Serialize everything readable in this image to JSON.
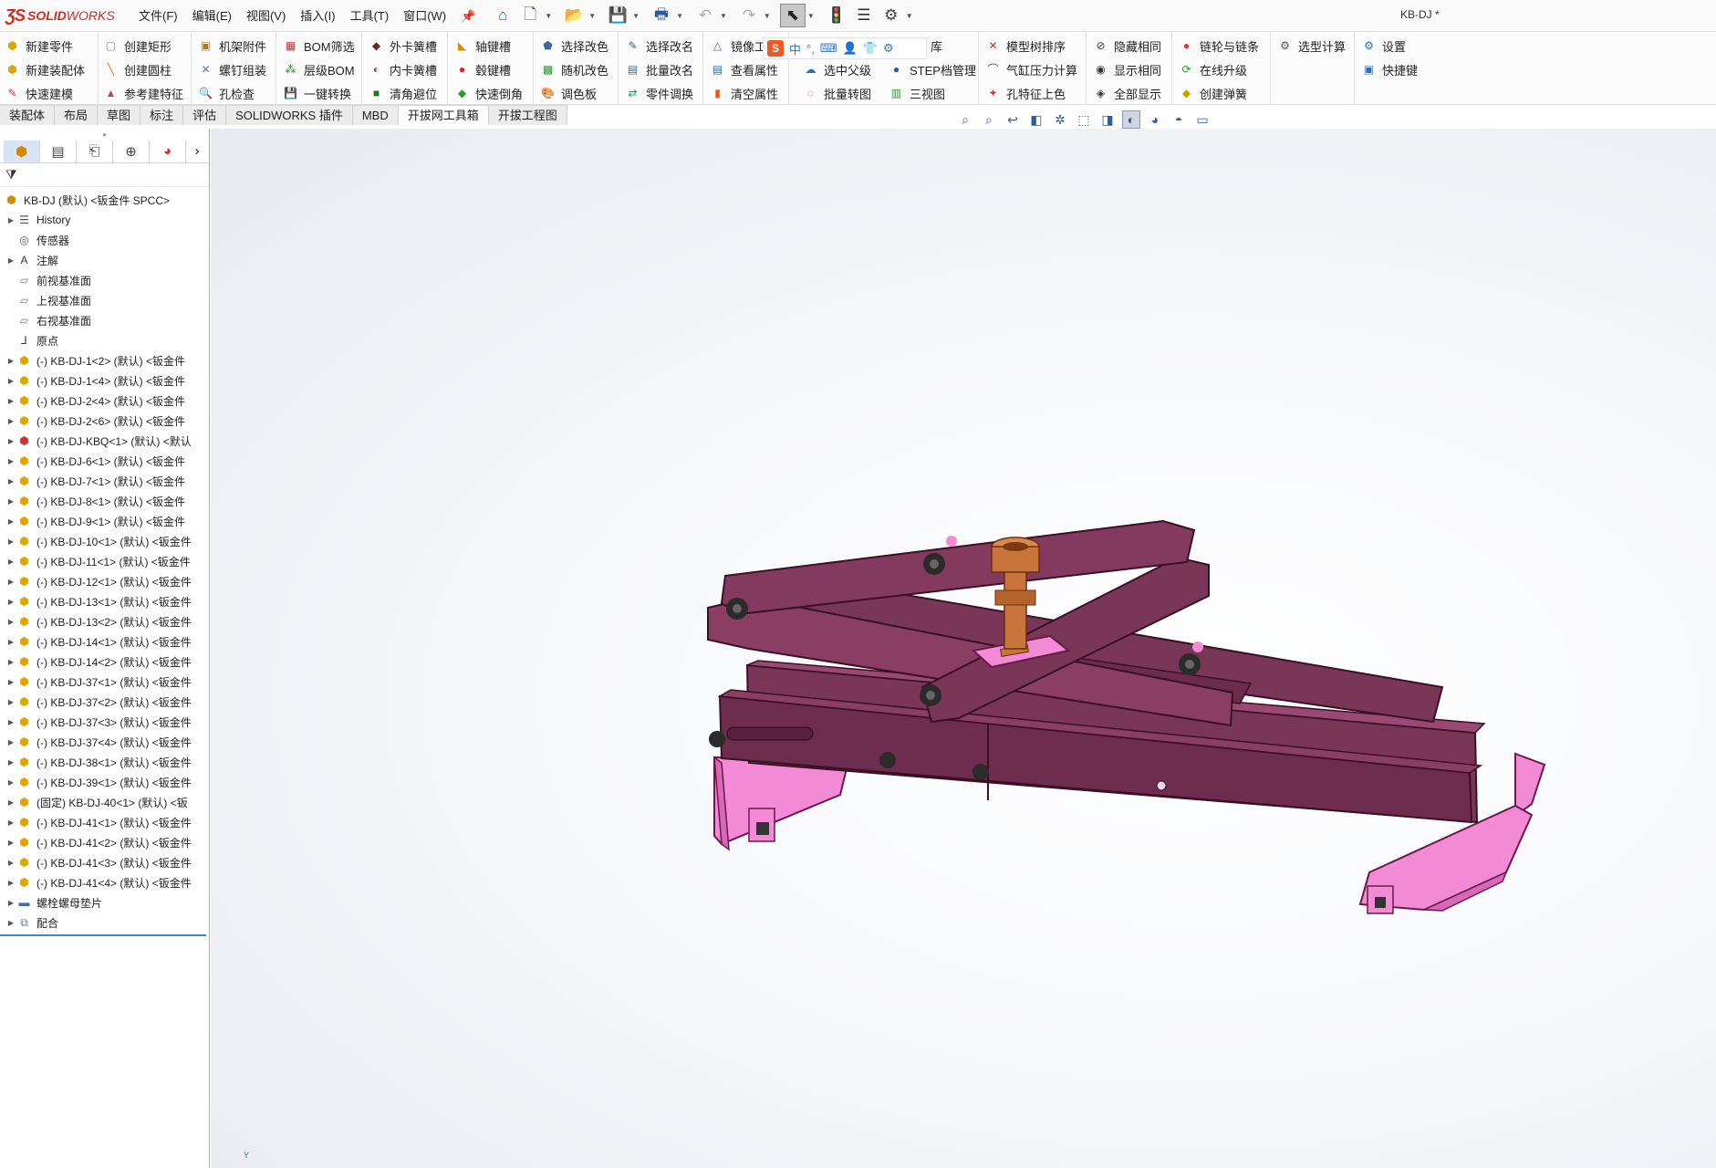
{
  "app": {
    "logo_mark": "ƷS",
    "logo_solid": "SOLID",
    "logo_works": "WORKS",
    "document_title": "KB-DJ *"
  },
  "menu": [
    "文件(F)",
    "编辑(E)",
    "视图(V)",
    "插入(I)",
    "工具(T)",
    "窗口(W)"
  ],
  "quick_access_icons": [
    "home-icon",
    "new-document-icon",
    "open-icon",
    "save-icon",
    "print-icon",
    "undo-icon",
    "redo-icon",
    "select-icon",
    "traffic-light-icon",
    "options-list-icon",
    "settings-gear-icon"
  ],
  "command_manager": {
    "col1": [
      "新建零件",
      "新建装配体",
      "快速建模"
    ],
    "col2": [
      "创建矩形",
      "创建圆柱",
      "参考建特征"
    ],
    "col3": [
      "机架附件",
      "螺钉组装",
      "孔检查"
    ],
    "col4": [
      "BOM筛选",
      "层级BOM",
      "一键转换"
    ],
    "col5": [
      "外卡簧槽",
      "内卡簧槽",
      "清角避位"
    ],
    "col6": [
      "轴键槽",
      "毂键槽",
      "快速倒角"
    ],
    "col7": [
      "选择改色",
      "随机改色",
      "调色板"
    ],
    "col8": [
      "选择改名",
      "批量改名",
      "零件调换"
    ],
    "col9": [
      "镜像工",
      "查看属性",
      "清空属性"
    ],
    "col10": [
      "库",
      "选中父级",
      "批量转图"
    ],
    "col10b": [
      "STEP档管理",
      "三视图"
    ],
    "col11": [
      "模型树排序",
      "气缸压力计算",
      "孔特征上色"
    ],
    "col12": [
      "隐藏相同",
      "显示相同",
      "全部显示"
    ],
    "col13": [
      "链轮与链条",
      "在线升级",
      "创建弹簧"
    ],
    "col14": [
      "选型计算"
    ],
    "col15": [
      "设置",
      "快捷键"
    ]
  },
  "ime_toolbar": {
    "logo": "S",
    "mode": "中",
    "items": [
      "°,",
      "⌨",
      "👤",
      "👕",
      "⚙"
    ]
  },
  "tabs": [
    "装配体",
    "布局",
    "草图",
    "标注",
    "评估",
    "SOLIDWORKS 插件",
    "MBD",
    "开拔网工具箱",
    "开拔工程图"
  ],
  "active_tab": "开拔网工具箱",
  "feature_manager": {
    "tab_icons": [
      "feature-tree-icon",
      "property-manager-icon",
      "configuration-manager-icon",
      "dimxpert-icon",
      "display-manager-icon"
    ],
    "filter_icon": "filter-icon",
    "root": "KB-DJ (默认) <钣金件 SPCC>",
    "items": [
      {
        "label": "History",
        "icon": "history-icon",
        "expandable": true
      },
      {
        "label": "传感器",
        "icon": "sensor-icon",
        "expandable": false
      },
      {
        "label": "注解",
        "icon": "annotation-icon",
        "expandable": true
      },
      {
        "label": "前视基准面",
        "icon": "plane-icon",
        "expandable": false
      },
      {
        "label": "上视基准面",
        "icon": "plane-icon",
        "expandable": false
      },
      {
        "label": "右视基准面",
        "icon": "plane-icon",
        "expandable": false
      },
      {
        "label": "原点",
        "icon": "origin-icon",
        "expandable": false
      },
      {
        "label": "(-) KB-DJ-1<2> (默认) <钣金件",
        "icon": "part-icon",
        "expandable": true
      },
      {
        "label": "(-) KB-DJ-1<4> (默认) <钣金件",
        "icon": "part-icon",
        "expandable": true
      },
      {
        "label": "(-) KB-DJ-2<4> (默认) <钣金件",
        "icon": "part-icon",
        "expandable": true
      },
      {
        "label": "(-) KB-DJ-2<6> (默认) <钣金件",
        "icon": "part-icon",
        "expandable": true
      },
      {
        "label": "(-) KB-DJ-KBQ<1> (默认) <默认",
        "icon": "subassembly-icon",
        "expandable": true
      },
      {
        "label": "(-) KB-DJ-6<1> (默认) <钣金件",
        "icon": "part-icon",
        "expandable": true
      },
      {
        "label": "(-) KB-DJ-7<1> (默认) <钣金件",
        "icon": "part-icon",
        "expandable": true
      },
      {
        "label": "(-) KB-DJ-8<1> (默认) <钣金件",
        "icon": "part-icon",
        "expandable": true
      },
      {
        "label": "(-) KB-DJ-9<1> (默认) <钣金件",
        "icon": "part-icon",
        "expandable": true
      },
      {
        "label": "(-) KB-DJ-10<1> (默认) <钣金件",
        "icon": "part-icon",
        "expandable": true
      },
      {
        "label": "(-) KB-DJ-11<1> (默认) <钣金件",
        "icon": "part-icon",
        "expandable": true
      },
      {
        "label": "(-) KB-DJ-12<1> (默认) <钣金件",
        "icon": "part-icon",
        "expandable": true
      },
      {
        "label": "(-) KB-DJ-13<1> (默认) <钣金件",
        "icon": "part-icon",
        "expandable": true
      },
      {
        "label": "(-) KB-DJ-13<2> (默认) <钣金件",
        "icon": "part-icon",
        "expandable": true
      },
      {
        "label": "(-) KB-DJ-14<1> (默认) <钣金件",
        "icon": "part-icon",
        "expandable": true
      },
      {
        "label": "(-) KB-DJ-14<2> (默认) <钣金件",
        "icon": "part-icon",
        "expandable": true
      },
      {
        "label": "(-) KB-DJ-37<1> (默认) <钣金件",
        "icon": "part-icon",
        "expandable": true
      },
      {
        "label": "(-) KB-DJ-37<2> (默认) <钣金件",
        "icon": "part-icon",
        "expandable": true
      },
      {
        "label": "(-) KB-DJ-37<3> (默认) <钣金件",
        "icon": "part-icon",
        "expandable": true
      },
      {
        "label": "(-) KB-DJ-37<4> (默认) <钣金件",
        "icon": "part-icon",
        "expandable": true
      },
      {
        "label": "(-) KB-DJ-38<1> (默认) <钣金件",
        "icon": "part-icon",
        "expandable": true
      },
      {
        "label": "(-) KB-DJ-39<1> (默认) <钣金件",
        "icon": "part-icon",
        "expandable": true
      },
      {
        "label": "(固定) KB-DJ-40<1> (默认) <钣",
        "icon": "part-icon",
        "expandable": true
      },
      {
        "label": "(-) KB-DJ-41<1> (默认) <钣金件",
        "icon": "part-icon",
        "expandable": true
      },
      {
        "label": "(-) KB-DJ-41<2> (默认) <钣金件",
        "icon": "part-icon",
        "expandable": true
      },
      {
        "label": "(-) KB-DJ-41<3> (默认) <钣金件",
        "icon": "part-icon",
        "expandable": true
      },
      {
        "label": "(-) KB-DJ-41<4> (默认) <钣金件",
        "icon": "part-icon",
        "expandable": true
      },
      {
        "label": "螺栓螺母垫片",
        "icon": "folder-icon",
        "expandable": true
      },
      {
        "label": "配合",
        "icon": "mates-icon",
        "expandable": true
      }
    ]
  },
  "graphics": {
    "triad_label": "Y",
    "colors": {
      "frame": "#7a3657",
      "frame_dark": "#4d1f37",
      "feet": "#f28ad5",
      "bronze": "#c8743a",
      "nut": "#2b2b2b"
    }
  }
}
